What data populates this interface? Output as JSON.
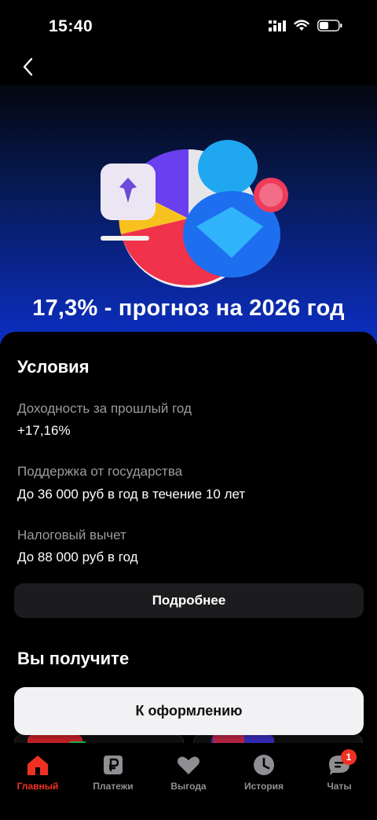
{
  "status_bar": {
    "time": "15:40"
  },
  "hero": {
    "title": "17,3% - прогноз на 2026 год"
  },
  "conditions": {
    "title": "Условия",
    "items": [
      {
        "label": "Доходность за прошлый год",
        "value": "+17,16%"
      },
      {
        "label": "Поддержка от государства",
        "value": "До 36 000 руб в год в течение 10 лет"
      },
      {
        "label": "Налоговый вычет",
        "value": "До 88 000 руб в год"
      }
    ],
    "more_label": "Подробнее"
  },
  "benefits": {
    "title": "Вы получите"
  },
  "cta": {
    "label": "К оформлению"
  },
  "tab_bar": {
    "tabs": [
      {
        "label": "Главный",
        "icon": "home-icon"
      },
      {
        "label": "Платежи",
        "icon": "ruble-icon"
      },
      {
        "label": "Выгода",
        "icon": "heart-icon"
      },
      {
        "label": "История",
        "icon": "clock-icon"
      },
      {
        "label": "Чаты",
        "icon": "chat-icon",
        "badge": "1"
      }
    ]
  },
  "colors": {
    "accent": "#ef3124",
    "hero_gradient_bottom": "#0c2fc4",
    "button_bg": "#1c1c1e"
  }
}
